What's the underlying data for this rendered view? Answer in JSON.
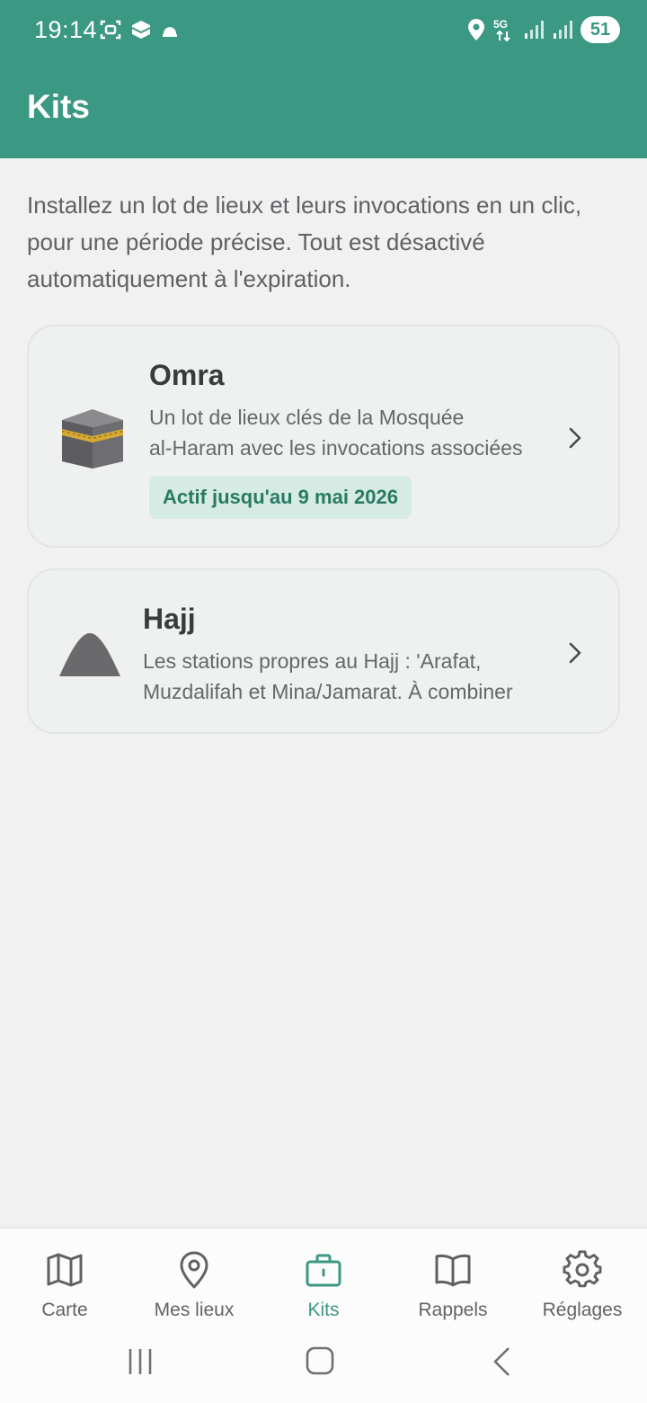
{
  "status_bar": {
    "time": "19:14",
    "network": "5G",
    "battery": "51"
  },
  "header": {
    "title": "Kits"
  },
  "intro": "Installez un lot de lieux et leurs invocations en un clic, pour une période précise. Tout est désactivé automatiquement à l'expiration.",
  "kits": [
    {
      "name": "Omra",
      "icon": "kaaba-icon",
      "description_lines": [
        "Un lot de lieux clés de la Mosquée",
        "al-Haram avec les invocations associées"
      ],
      "badge": "Actif jusqu'au 9 mai 2026"
    },
    {
      "name": "Hajj",
      "icon": "mountain-icon",
      "description_lines": [
        "Les stations propres au Hajj : 'Arafat,",
        "Muzdalifah et Mina/Jamarat. À combiner"
      ]
    }
  ],
  "nav": {
    "items": [
      {
        "label": "Carte",
        "icon": "map-icon"
      },
      {
        "label": "Mes lieux",
        "icon": "location-pin-icon"
      },
      {
        "label": "Kits",
        "icon": "briefcase-icon",
        "active": true
      },
      {
        "label": "Rappels",
        "icon": "book-icon"
      },
      {
        "label": "Réglages",
        "icon": "gear-icon"
      }
    ]
  },
  "colors": {
    "primary": "#3b9883",
    "background": "#f1f1f1",
    "badge_bg": "#d5ebe3",
    "badge_text": "#2a7a63"
  }
}
